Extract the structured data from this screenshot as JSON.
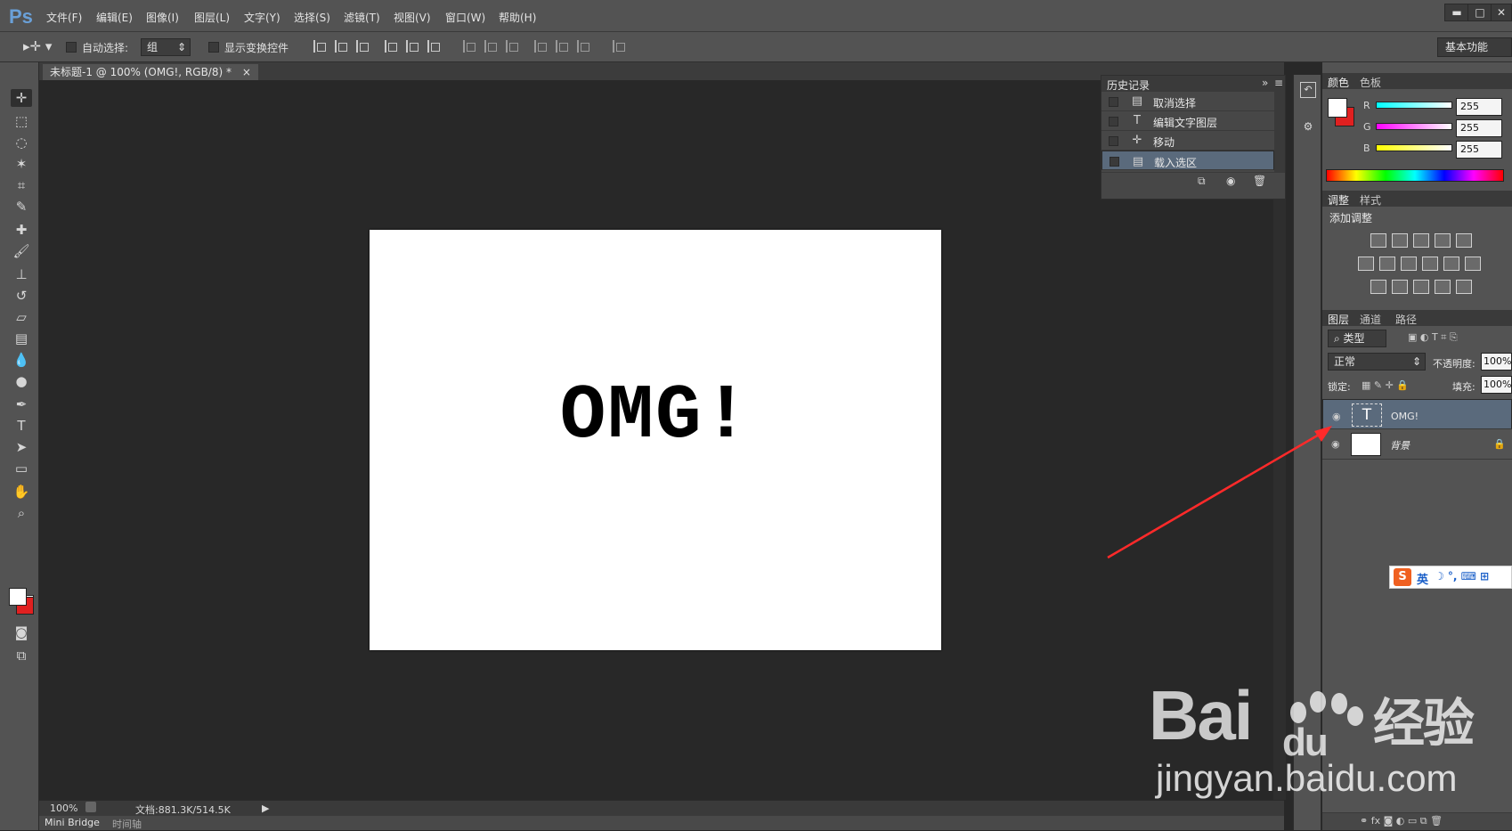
{
  "app": {
    "logo": "Ps",
    "accent": "#6aa0d8"
  },
  "menu": [
    "文件(F)",
    "编辑(E)",
    "图像(I)",
    "图层(L)",
    "文字(Y)",
    "选择(S)",
    "滤镜(T)",
    "视图(V)",
    "窗口(W)",
    "帮助(H)"
  ],
  "window_buttons": [
    "▬",
    "□",
    "✕"
  ],
  "options": {
    "auto_select_label": "自动选择:",
    "auto_select_value": "组",
    "transform_label": "显示变换控件",
    "workspace": "基本功能"
  },
  "document": {
    "tab_title": "未标题-1 @ 100% (OMG!, RGB/8) *",
    "close": "×",
    "canvas_text": "OMG!",
    "zoom": "100%",
    "doc_info": "文档:881.3K/514.5K"
  },
  "bottom_tabs": [
    "Mini Bridge",
    "时间轴"
  ],
  "history": {
    "title": "历史记录",
    "items": [
      {
        "label": "取消选择",
        "icon": "document-icon"
      },
      {
        "label": "编辑文字图层",
        "icon": "type-icon"
      },
      {
        "label": "移动",
        "icon": "move-icon"
      },
      {
        "label": "载入选区",
        "icon": "document-icon",
        "selected": true
      }
    ]
  },
  "color_panel": {
    "tabs": [
      "颜色",
      "色板"
    ],
    "channels": [
      {
        "name": "R",
        "value": "255"
      },
      {
        "name": "G",
        "value": "255"
      },
      {
        "name": "B",
        "value": "255"
      }
    ],
    "foreground": "#ffffff",
    "background": "#e02020"
  },
  "adjust_panel": {
    "tabs": [
      "调整",
      "样式"
    ],
    "title": "添加调整"
  },
  "layers_panel": {
    "tabs": [
      "图层",
      "通道",
      "路径"
    ],
    "filter_label": "类型",
    "blend_mode": "正常",
    "opacity_label": "不透明度:",
    "opacity": "100%",
    "lock_label": "锁定:",
    "fill_label": "填充:",
    "fill": "100%",
    "layers": [
      {
        "name": "OMG!",
        "type": "text",
        "selected": true
      },
      {
        "name": "背景",
        "type": "background",
        "locked": true
      }
    ]
  },
  "ime": {
    "mode": "英"
  },
  "watermark": {
    "logo": "Bai du 经验",
    "url": "jingyan.baidu.com"
  }
}
